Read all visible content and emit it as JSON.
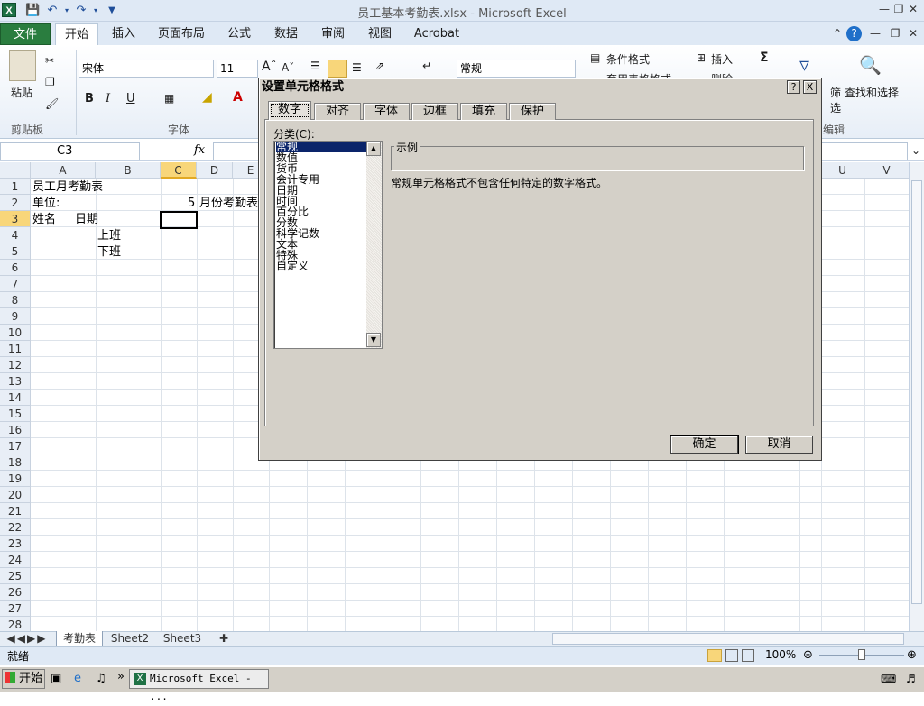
{
  "window": {
    "title": "员工基本考勤表.xlsx - Microsoft Excel"
  },
  "app_icon": "X",
  "menu": {
    "file": "文件",
    "tabs": [
      "开始",
      "插入",
      "页面布局",
      "公式",
      "数据",
      "审阅",
      "视图",
      "Acrobat"
    ]
  },
  "ribbon": {
    "paste": "粘贴",
    "clipboard_label": "剪贴板",
    "font_name": "宋体",
    "font_size": "11",
    "font_label": "字体",
    "number_format": "常规",
    "cond_format": "条件格式",
    "table_format": "套用表格格式",
    "insert": "插入",
    "delete": "删除",
    "filter": "筛选",
    "find_select": "查找和选择",
    "edit_label": "编辑",
    "bold": "B",
    "italic": "I",
    "underline": "U",
    "sum": "Σ"
  },
  "formula": {
    "namebox": "C3",
    "fx": "fx",
    "value": ""
  },
  "columns": [
    "A",
    "B",
    "C",
    "D",
    "E",
    "U",
    "V"
  ],
  "rows": [
    "1",
    "2",
    "3",
    "4",
    "5",
    "6",
    "7",
    "8",
    "9",
    "10",
    "11",
    "12",
    "13",
    "14",
    "15",
    "16",
    "17",
    "18",
    "19",
    "20",
    "21",
    "22",
    "23",
    "24",
    "25",
    "26",
    "27",
    "28"
  ],
  "cells": {
    "a1": "员工月考勤表",
    "a2": "单位:",
    "c2": "5",
    "d2": "月份考勤表",
    "a3": "姓名",
    "b3": "日期",
    "b4": "上班",
    "b5": "下班"
  },
  "sheets": [
    "考勤表",
    "Sheet2",
    "Sheet3"
  ],
  "status": {
    "ready": "就绪",
    "zoom": "100%"
  },
  "taskbar": {
    "start": "开始",
    "task": "Microsoft Excel - ..."
  },
  "dialog": {
    "title": "设置单元格格式",
    "help": "?",
    "close": "X",
    "tabs": [
      "数字",
      "对齐",
      "字体",
      "边框",
      "填充",
      "保护"
    ],
    "category_label": "分类(C):",
    "categories": [
      "常规",
      "数值",
      "货币",
      "会计专用",
      "日期",
      "时间",
      "百分比",
      "分数",
      "科学记数",
      "文本",
      "特殊",
      "自定义"
    ],
    "selected_category": "常规",
    "sample_label": "示例",
    "description": "常规单元格格式不包含任何特定的数字格式。",
    "ok": "确定",
    "cancel": "取消"
  },
  "colors": {
    "file_tab": "#2a7d3f",
    "selection": "#0a246a",
    "active_header": "#f8d67a"
  }
}
